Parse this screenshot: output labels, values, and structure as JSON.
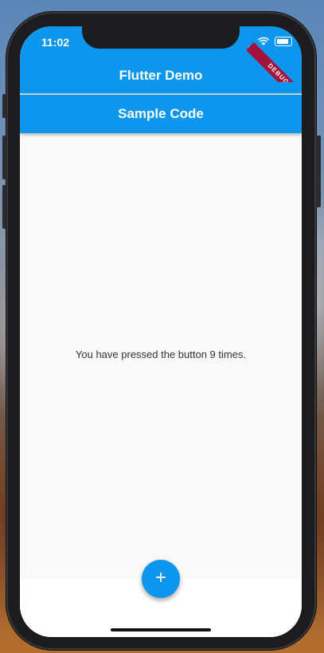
{
  "status_bar": {
    "time": "11:02",
    "signal": "....",
    "wifi_icon": "wifi-icon",
    "battery_icon": "battery-icon"
  },
  "debug_banner": "DEBUG",
  "app_bar": {
    "title": "Flutter Demo"
  },
  "sub_bar": {
    "title": "Sample Code"
  },
  "main": {
    "counter_text": "You have pressed the button 9 times."
  },
  "fab": {
    "label": "+",
    "icon": "plus-icon"
  },
  "colors": {
    "primary": "#0d96ee",
    "debug": "#a3123c",
    "background": "#fafafa"
  }
}
